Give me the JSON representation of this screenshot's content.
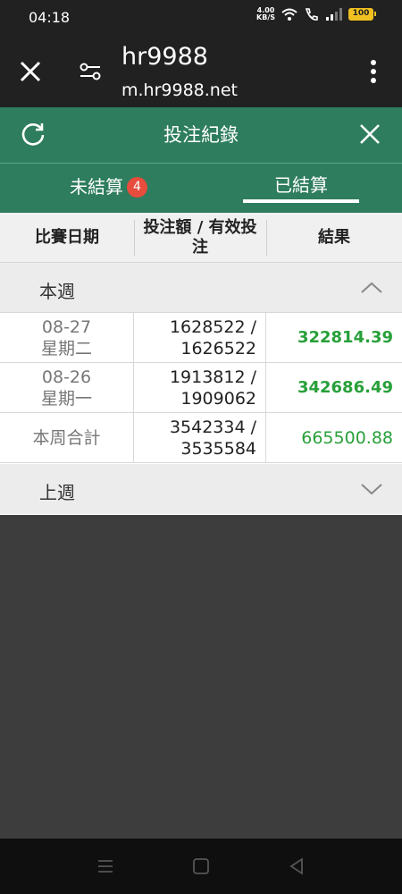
{
  "status_bar": {
    "time": "04:18",
    "net_speed_value": "4.00",
    "net_speed_unit": "KB/S",
    "battery": "100"
  },
  "browser": {
    "site_title": "hr9988",
    "url": "m.hr9988.net"
  },
  "dialog": {
    "title": "投注紀錄"
  },
  "tabs": {
    "unsettled_label": "未結算",
    "unsettled_badge": "4",
    "settled_label": "已結算",
    "active": "settled"
  },
  "table": {
    "headers": [
      "比賽日期",
      "投注額 / 有效投注",
      "結果"
    ],
    "this_week": {
      "label": "本週",
      "expanded": true,
      "rows": [
        {
          "date": "08-27",
          "weekday": "星期二",
          "stake": "1628522 /",
          "valid": "1626522",
          "result": "322814.39"
        },
        {
          "date": "08-26",
          "weekday": "星期一",
          "stake": "1913812 /",
          "valid": "1909062",
          "result": "342686.49"
        }
      ],
      "total": {
        "label": "本周合計",
        "stake": "3542334 /",
        "valid": "3535584",
        "result": "665500.88"
      }
    },
    "last_week": {
      "label": "上週",
      "expanded": false
    }
  },
  "colors": {
    "header_green": "#2e7d5e",
    "result_green": "#28a03a",
    "badge_red": "#e74c3c"
  }
}
